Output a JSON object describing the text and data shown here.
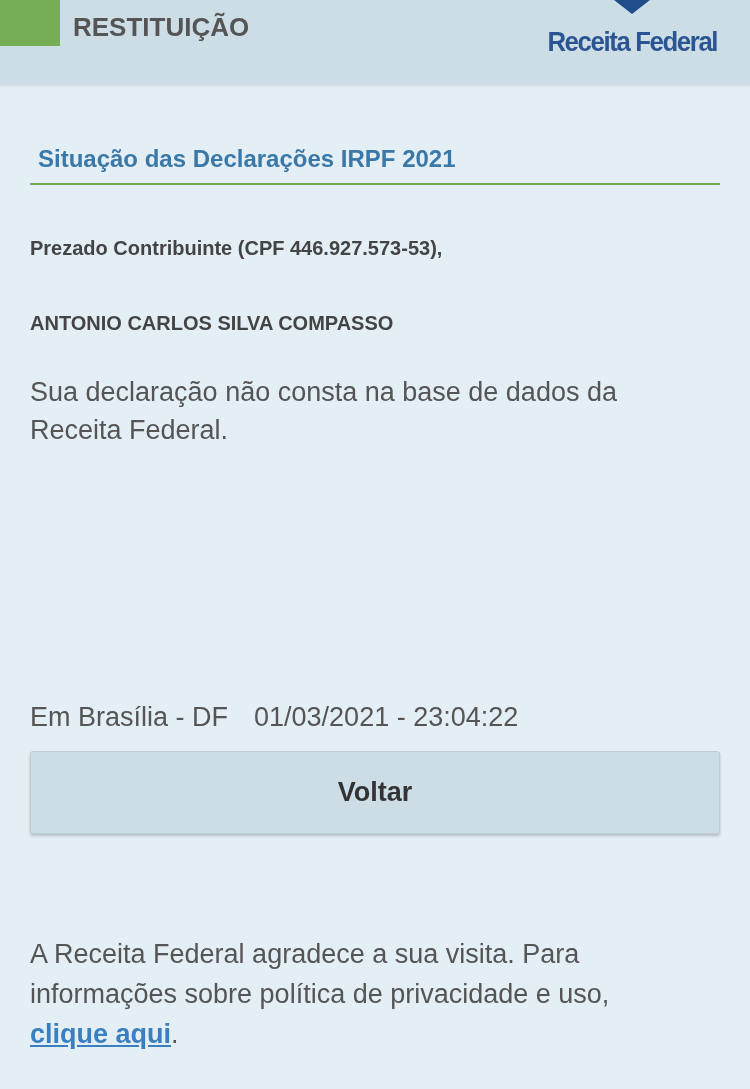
{
  "header": {
    "title": "RESTITUIÇÃO",
    "logo_text": "Receita Federal"
  },
  "page_title": "Situação das Declarações IRPF 2021",
  "greeting": "Prezado Contribuinte (CPF 446.927.573-53),",
  "taxpayer_name": "ANTONIO CARLOS SILVA COMPASSO",
  "message": "Sua declaração não consta na base de dados da Receita Federal.",
  "place": "Em Brasília - DF",
  "timestamp": "01/03/2021 - 23:04:22",
  "back_button": "Voltar",
  "footer": {
    "text": "A Receita Federal agradece a sua visita. Para informações sobre política de privacidade e uso,",
    "link": "clique aqui",
    "end": "."
  }
}
